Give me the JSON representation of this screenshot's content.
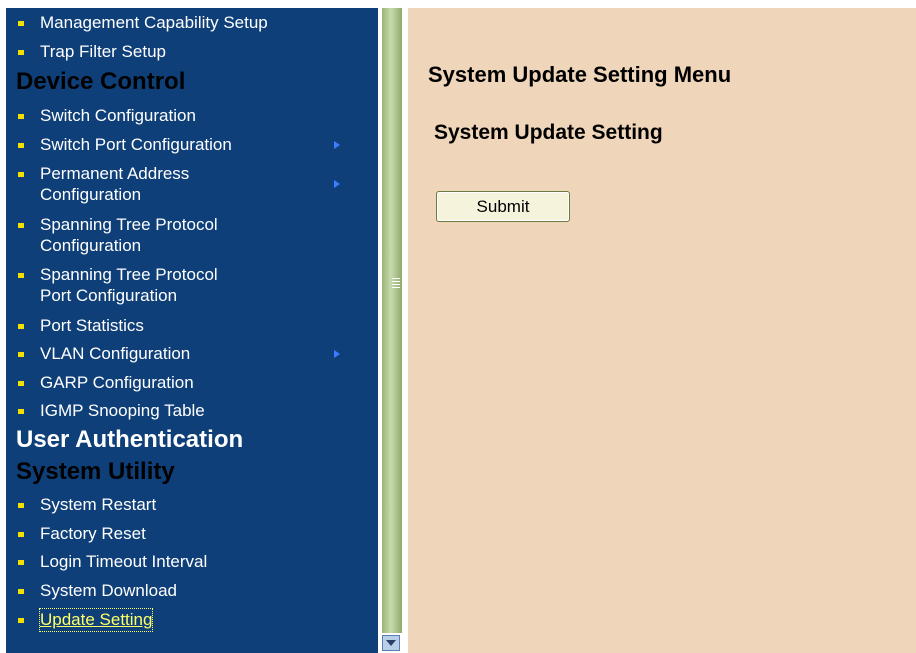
{
  "sidebar": {
    "items": {
      "management_capability": "Management Capability Setup",
      "trap_filter": "Trap Filter Setup",
      "switch_config": "Switch Configuration",
      "switch_port_config": "Switch Port Configuration",
      "permanent_address_l1": "Permanent Address",
      "permanent_address_l2": "Configuration",
      "stp_config_l1": "Spanning Tree Protocol",
      "stp_config_l2": "Configuration",
      "stp_port_l1": "Spanning Tree Protocol",
      "stp_port_l2": "Port Configuration",
      "port_statistics": "Port Statistics",
      "vlan_config": "VLAN Configuration",
      "garp_config": "GARP Configuration",
      "igmp_snooping": "IGMP Snooping Table",
      "system_restart": "System Restart",
      "factory_reset": "Factory Reset",
      "login_timeout": "Login Timeout Interval",
      "system_download": "System Download",
      "update_setting": "Update Setting"
    },
    "sections": {
      "device_control": "Device Control",
      "user_authentication": "User Authentication",
      "system_utility": "System Utility"
    }
  },
  "main": {
    "page_title": "System Update Setting Menu",
    "section_title": "System Update Setting",
    "submit_label": "Submit"
  },
  "colors": {
    "sidebar_bg": "#0f3f78",
    "main_bg": "#efd5b9",
    "bullet": "#f2e100"
  }
}
